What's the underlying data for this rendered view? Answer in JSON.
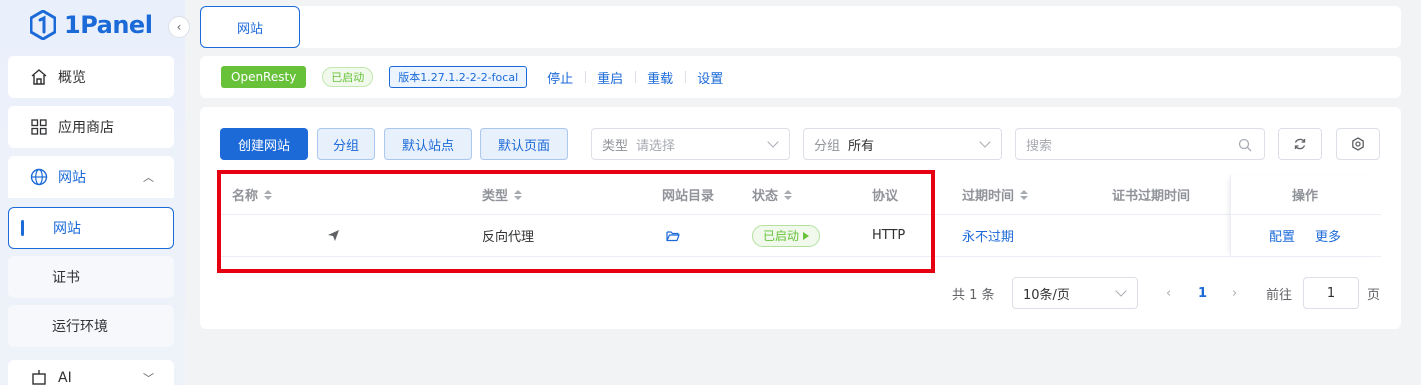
{
  "brand": {
    "name": "1Panel",
    "accent": "#1b6ad8"
  },
  "sidebar": {
    "items": [
      {
        "label": "概览",
        "icon": "home-icon"
      },
      {
        "label": "应用商店",
        "icon": "grid-icon"
      },
      {
        "label": "网站",
        "icon": "globe-icon",
        "expanded": true,
        "children": [
          {
            "label": "网站",
            "active": true
          },
          {
            "label": "证书"
          },
          {
            "label": "运行环境"
          }
        ]
      },
      {
        "label": "AI",
        "icon": "robot-icon"
      }
    ]
  },
  "tabs": [
    {
      "label": "网站",
      "active": true
    }
  ],
  "status": {
    "app": "OpenResty",
    "state": "已启动",
    "version": "版本1.27.1.2-2-2-focal",
    "actions": [
      "停止",
      "重启",
      "重载",
      "设置"
    ]
  },
  "toolbar": {
    "create": "创建网站",
    "group": "分组",
    "default_site": "默认站点",
    "default_page": "默认页面",
    "type_label": "类型",
    "type_placeholder": "请选择",
    "group_label": "分组",
    "group_value": "所有",
    "search_placeholder": "搜索"
  },
  "table": {
    "columns": [
      "名称",
      "类型",
      "网站目录",
      "状态",
      "协议",
      "过期时间",
      "证书过期时间",
      "操作"
    ],
    "rows": [
      {
        "name": "",
        "type": "反向代理",
        "status": "已启动",
        "protocol": "HTTP",
        "expire": "永不过期",
        "cert_expire": "",
        "ops": [
          "配置",
          "更多"
        ]
      }
    ]
  },
  "pagination": {
    "total_text": "共 1 条",
    "page_size": "10条/页",
    "current": "1",
    "goto_label": "前往",
    "goto_value": "1",
    "page_unit": "页"
  },
  "colors": {
    "success": "#67c23a",
    "highlight_box": "#e60012"
  }
}
